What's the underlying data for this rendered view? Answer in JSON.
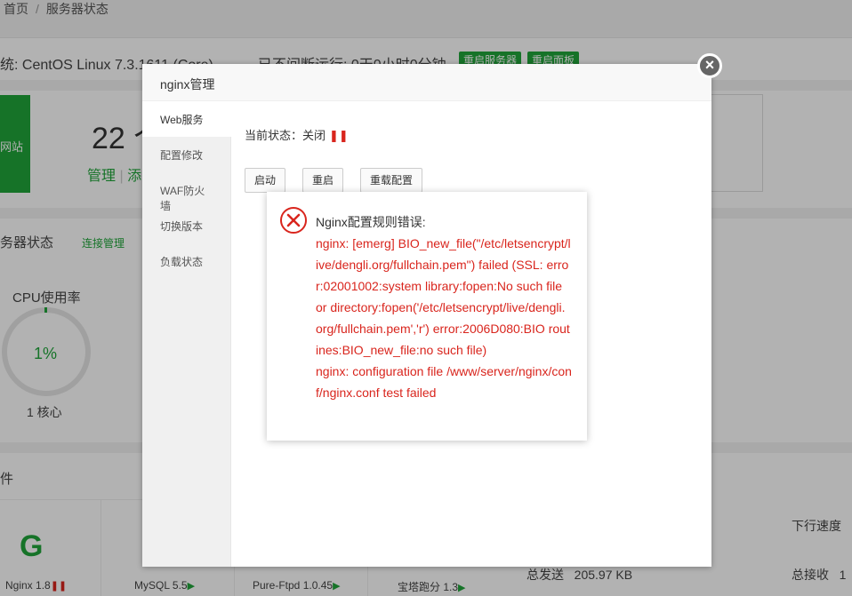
{
  "breadcrumb": {
    "home": "首页",
    "separator": "/",
    "current": "服务器状态"
  },
  "system": {
    "os_text": "统: CentOS Linux 7.3.1611 (Core)",
    "uptime_text": "已不间断运行: 0天0小时0分钟",
    "restart_server": "重启服务器",
    "restart_panel": "重启面板"
  },
  "stats": {
    "site_label": "网站",
    "site_count": "22 个",
    "manage_link": "管理",
    "sep": "|",
    "more": "添"
  },
  "server_state": {
    "title": "务器状态",
    "link": "连接管理",
    "cpu_label": "CPU使用率",
    "cpu_value": "1%",
    "cpu_fraction": 0.01,
    "cores": "1 核心"
  },
  "software": {
    "title": "件",
    "items": [
      {
        "name": "Nginx 1.8",
        "status": "stopped"
      },
      {
        "name": "MySQL 5.5",
        "status": "running"
      },
      {
        "name": "Pure-Ftpd 1.0.45",
        "status": "running"
      },
      {
        "name": "宝塔跑分 1.3",
        "status": "running"
      }
    ],
    "logo_glyph": "G"
  },
  "network": {
    "down_speed_label": "下行速度",
    "sent_label": "总发送",
    "sent_value": "205.97 KB",
    "recv_label": "总接收",
    "recv_value": "1"
  },
  "nginx_panel": {
    "title": "nginx管理",
    "menu": [
      "Web服务",
      "配置修改",
      "WAF防火墙",
      "切换版本",
      "负载状态"
    ],
    "status_label": "当前状态：关闭",
    "status_icon": "❚❚",
    "buttons": {
      "start": "启动",
      "restart": "重启",
      "reload": "重载配置"
    },
    "close_glyph": "×"
  },
  "error_dialog": {
    "title": "Nginx配置规则错误:",
    "message": "nginx: [emerg] BIO_new_file(\"/etc/letsencrypt/live/dengli.org/fullchain.pem\") failed (SSL: error:02001002:system library:fopen:No such file or directory:fopen('/etc/letsencrypt/live/dengli.org/fullchain.pem','r') error:2006D080:BIO routines:BIO_new_file:no such file)\nnginx: configuration file /www/server/nginx/conf/nginx.conf test failed",
    "icon": "error-x-icon"
  },
  "colors": {
    "accent": "#20a53a",
    "error": "#d9251d"
  }
}
